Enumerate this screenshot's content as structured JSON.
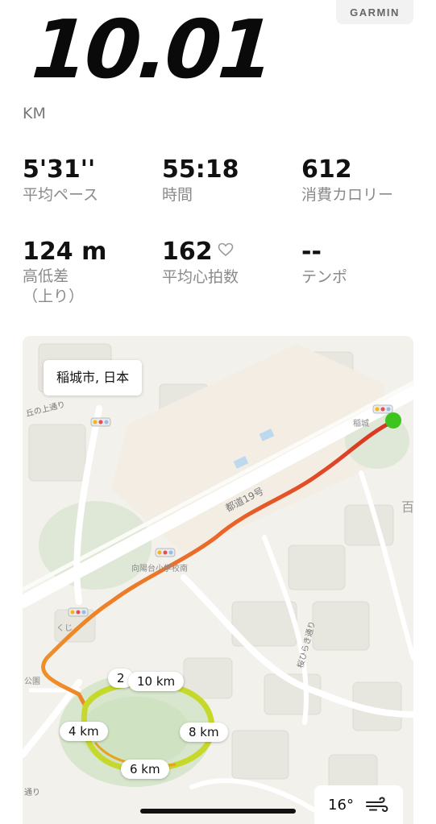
{
  "brand": "GARMIN",
  "distance": {
    "value": "10.01",
    "unit": "KM"
  },
  "stats": [
    {
      "value": "5'31''",
      "label": "平均ペース"
    },
    {
      "value": "55:18",
      "label": "時間"
    },
    {
      "value": "612",
      "label": "消費カロリー"
    },
    {
      "value": "124 m",
      "label": "高低差\n（上り）"
    },
    {
      "value": "162",
      "label": "平均心拍数"
    },
    {
      "value": "--",
      "label": "テンポ"
    }
  ],
  "map": {
    "location": "稲城市, 日本",
    "street_labels": {
      "road_19": "都道19号",
      "okanoue": "丘の上通り",
      "stop_inagi": "稲城",
      "stop_mukaiyodai": "向陽台小学校南",
      "stop_kuji": "くじ",
      "park": "公園",
      "sakura": "桜ひらき通り",
      "dori": "通り",
      "hyaku": "百"
    },
    "km_markers": [
      "2",
      "10 km",
      "4 km",
      "8 km",
      "6 km"
    ],
    "route_colors": {
      "fast": "#f08a1e",
      "mid": "#e9601f",
      "slow": "#d82a1a",
      "loop": "#c6d92a"
    },
    "start_color": "#3dc41f"
  },
  "weather": {
    "temperature": "16°",
    "icon": "wind-icon"
  }
}
